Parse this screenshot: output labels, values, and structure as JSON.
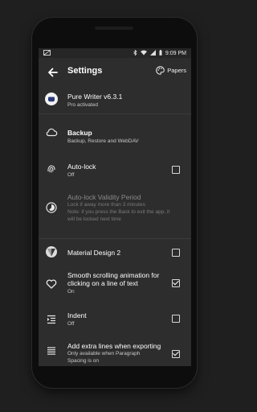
{
  "status_bar": {
    "time": "9:09 PM"
  },
  "app_bar": {
    "title": "Settings",
    "papers_label": "Papers"
  },
  "settings": {
    "version": {
      "title": "Pure Writer v6.3.1",
      "subtitle": "Pro activated"
    },
    "backup": {
      "title": "Backup",
      "subtitle": "Backup, Restore and WebDAV"
    },
    "auto_lock": {
      "title": "Auto-lock",
      "subtitle": "Off",
      "checked": false
    },
    "auto_lock_period": {
      "title": "Auto-lock Validity Period",
      "line1": "Lock if away more than 3 minutes",
      "line2": "Note: if you press the Back to exit the app, it",
      "line3": "will be locked next time"
    },
    "material": {
      "title": "Material Design 2",
      "checked": false
    },
    "smooth": {
      "line1": "Smooth scrolling animation for",
      "line2": "clicking on a line of text",
      "subtitle": "On",
      "checked": true
    },
    "indent": {
      "title": "Indent",
      "subtitle": "Off",
      "checked": false
    },
    "extra_lines": {
      "title": "Add extra lines when exporting",
      "line1": "Only available when Paragraph",
      "line2": "Spacing is on",
      "checked": true
    }
  },
  "colors": {
    "background": "#1f1f1f",
    "screen": "#2d2d2d",
    "text": "#ffffff",
    "subtext": "#c9c9c9"
  }
}
